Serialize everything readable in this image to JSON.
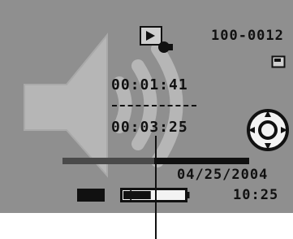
{
  "screen": {
    "file_number": "100-0012",
    "elapsed_time": "00:01:41",
    "total_time": "00:03:25",
    "date": "04/25/2004",
    "time": "10:25",
    "playback_progress": 0.49,
    "battery_level": 0.45
  },
  "icons": {
    "mode": "play-mode-icon",
    "protect": "protect-icon",
    "control": "control-dial-icon",
    "volume": "volume-icon",
    "speaker": "speaker-background-icon",
    "battery": "battery-icon"
  },
  "colors": {
    "screen_bg": "#8f8f8f",
    "foreground": "#111111",
    "speaker_fill": "#b6b6b6",
    "progress_fill": "#4a4a4a"
  }
}
